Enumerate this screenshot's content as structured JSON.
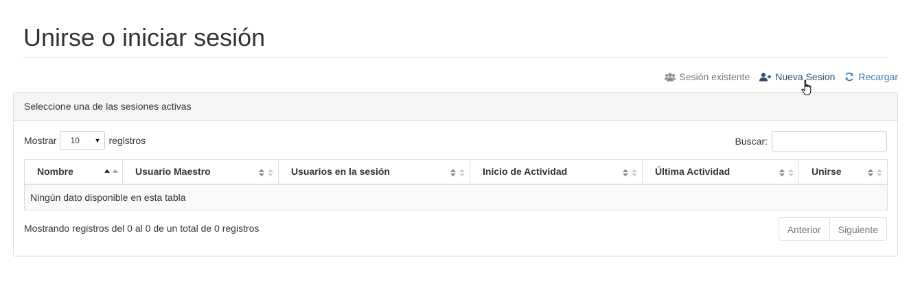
{
  "page": {
    "title": "Unirse o iniciar sesión"
  },
  "actions": {
    "existing_session": {
      "label": "Sesión existente",
      "icon": "users-icon"
    },
    "new_session": {
      "label": "Nueva Sesion",
      "icon": "user-plus-icon"
    },
    "reload": {
      "label": "Recargar",
      "icon": "refresh-icon"
    }
  },
  "panel": {
    "heading": "Seleccione una de las sesiones activas"
  },
  "table_controls": {
    "show_label": "Mostrar",
    "page_length": "10",
    "records_label": "registros",
    "search_label": "Buscar:",
    "search_value": ""
  },
  "table": {
    "columns": [
      "Nombre",
      "Usuario Maestro",
      "Usuarios en la sesión",
      "Inicio de Actividad",
      "Última Actividad",
      "Unirse"
    ],
    "empty_message": "Ningún dato disponible en esta tabla"
  },
  "footer": {
    "info": "Mostrando registros del 0 al 0 de un total de 0 registros",
    "prev_label": "Anterior",
    "next_label": "Siguiente"
  },
  "colors": {
    "link": "#337ab7",
    "muted": "#777777",
    "border": "#dddddd"
  }
}
